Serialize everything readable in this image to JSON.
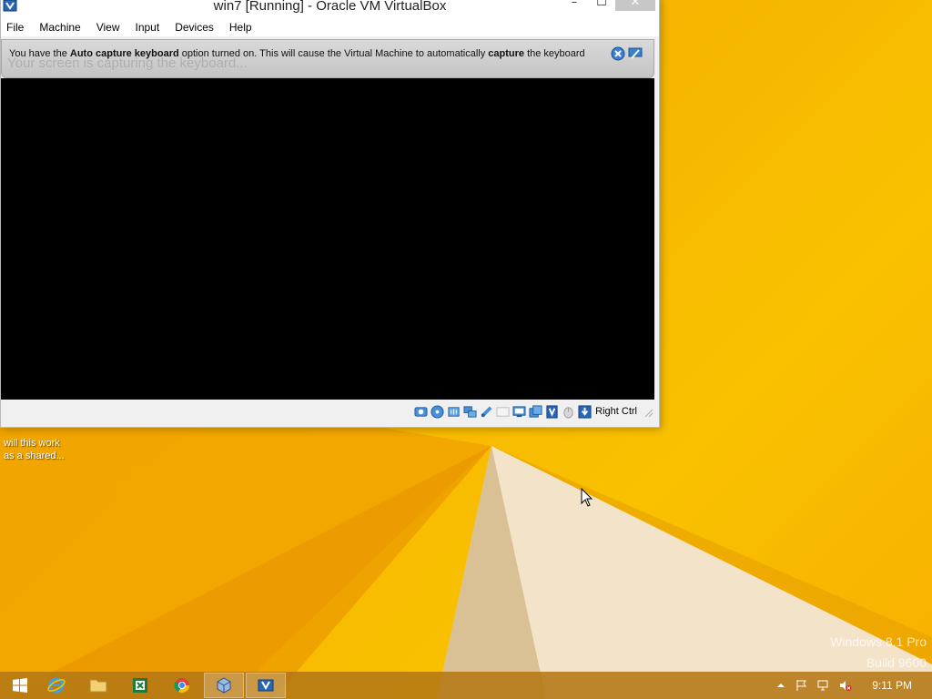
{
  "window": {
    "title": "win7 [Running] - Oracle VM VirtualBox",
    "buttons": {
      "minimize": "–",
      "maximize": "☐",
      "close": "✕"
    }
  },
  "menu": [
    "File",
    "Machine",
    "View",
    "Input",
    "Devices",
    "Help"
  ],
  "notice": {
    "ghost_text": "Your screen is capturing the keyboard...",
    "text_prefix": "You have the ",
    "text_bold1": "Auto capture keyboard",
    "text_middle": " option turned on. This will cause the Virtual Machine to automatically ",
    "text_bold2": "capture",
    "text_suffix": " the keyboard"
  },
  "statusbar": {
    "icons": [
      "hard-disk-icon",
      "optical-drive-icon",
      "audio-icon",
      "network-icon",
      "usb-icon",
      "shared-folders-icon",
      "display-icon",
      "video-capture-icon",
      "vt-x-icon",
      "mouse-integration-icon",
      "keyboard-capture-icon"
    ],
    "host_key": "Right Ctrl"
  },
  "desktop": {
    "icon_label_line1": "will this work",
    "icon_label_line2": "as a shared..."
  },
  "watermark": {
    "line1": "Windows 8.1 Pro",
    "line2": "Build 9600"
  },
  "taskbar": {
    "apps": [
      "windows-start-icon",
      "internet-explorer-icon",
      "file-explorer-icon",
      "excel-icon",
      "chrome-icon",
      "virtualbox-manager-icon",
      "virtualbox-vm-icon"
    ],
    "tray": [
      "show-hidden-icons-arrow",
      "action-center-flag-icon",
      "network-icon",
      "volume-muted-icon"
    ],
    "clock": "9:11 PM"
  },
  "colors": {
    "wallpaper": "#f6b400",
    "taskbar": "#b47814",
    "vm_screen": "#000000"
  }
}
